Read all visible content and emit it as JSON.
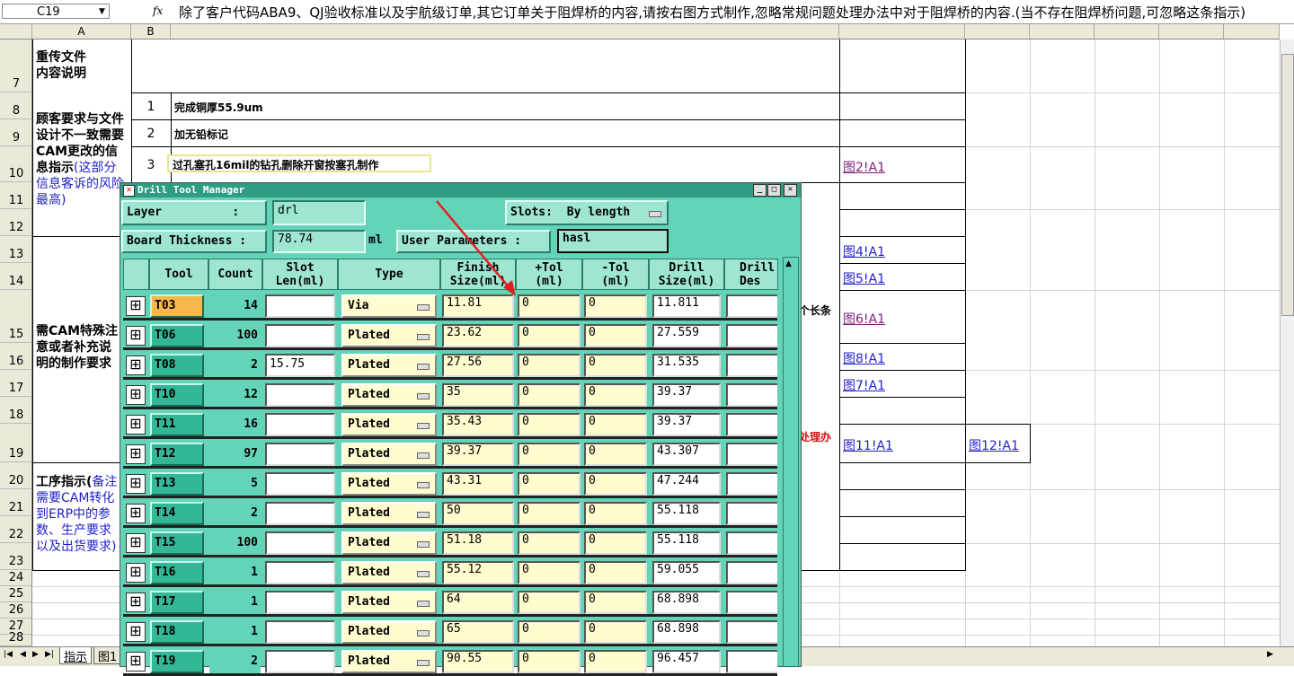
{
  "formula_bar": {
    "name_box": "C19",
    "fx": "fx",
    "formula": "除了客户代码ABA9、QJ验收标准以及宇航级订单,其它订单关于阻焊桥的内容,请按右图方式制作,忽略常规问题处理办法中对于阻焊桥的内容.(当不存在阻焊桥问题,可忽略这条指示)"
  },
  "columns": [
    "A",
    "B"
  ],
  "rows": [
    "7",
    "8",
    "9",
    "10",
    "11",
    "12",
    "13",
    "14",
    "15",
    "16",
    "17",
    "18",
    "19",
    "20",
    "21",
    "22",
    "23",
    "24",
    "25",
    "26",
    "27",
    "28"
  ],
  "sheet": {
    "a7": "重传文件\n内容说明",
    "a8_black": "顾客要求与文件设计不一致需要CAM更改的信息指示",
    "a8_blue": "(这部分信息客诉的风险最高)",
    "a15": "需CAM特殊注意或者补充说明的制作要求",
    "a20_black": "工序指示(",
    "a20_blue": "备注需要CAM转化到ERP中的参数、生产要求以及出货要求)",
    "b8": "1",
    "c8": "完成铜厚55.9um",
    "b9": "2",
    "c9": "加无铅标记",
    "b10": "3",
    "c10": "过孔塞孔16mil的钻孔删除开窗按塞孔制作",
    "frag15": "个长条",
    "frag19": "处理办",
    "links": {
      "r10": "图2!A1",
      "r13": "图4!A1",
      "r14": "图5!A1",
      "r15": "图6!A1",
      "r16": "图8!A1",
      "r17": "图7!A1",
      "r19a": "图11!A1",
      "r19b": "图12!A1"
    }
  },
  "sheet_tabs": [
    "指示",
    "图1"
  ],
  "dialog": {
    "title": "Drill Tool Manager",
    "layer_label": "Layer          :",
    "layer_value": "drl",
    "slots_label": "Slots:",
    "slots_value": "By length",
    "thickness_label": "Board Thickness :",
    "thickness_value": "78.74",
    "thickness_unit": "ml",
    "user_params_label": "User Parameters :",
    "user_params_value": "hasl",
    "headers": [
      "Tool",
      "Count",
      "Slot\nLen(ml)",
      "Type",
      "Finish\nSize(ml)",
      "+Tol\n(ml)",
      "-Tol\n(ml)",
      "Drill\nSize(ml)",
      "Drill\nDes"
    ],
    "tools": [
      {
        "tool": "T03",
        "count": "14",
        "slot": "",
        "type": "Via",
        "finish": "11.81",
        "ptol": "0",
        "ntol": "0",
        "drill": "11.811"
      },
      {
        "tool": "T06",
        "count": "100",
        "slot": "",
        "type": "Plated",
        "finish": "23.62",
        "ptol": "0",
        "ntol": "0",
        "drill": "27.559"
      },
      {
        "tool": "T08",
        "count": "2",
        "slot": "15.75",
        "type": "Plated",
        "finish": "27.56",
        "ptol": "0",
        "ntol": "0",
        "drill": "31.535"
      },
      {
        "tool": "T10",
        "count": "12",
        "slot": "",
        "type": "Plated",
        "finish": "35",
        "ptol": "0",
        "ntol": "0",
        "drill": "39.37"
      },
      {
        "tool": "T11",
        "count": "16",
        "slot": "",
        "type": "Plated",
        "finish": "35.43",
        "ptol": "0",
        "ntol": "0",
        "drill": "39.37"
      },
      {
        "tool": "T12",
        "count": "97",
        "slot": "",
        "type": "Plated",
        "finish": "39.37",
        "ptol": "0",
        "ntol": "0",
        "drill": "43.307"
      },
      {
        "tool": "T13",
        "count": "5",
        "slot": "",
        "type": "Plated",
        "finish": "43.31",
        "ptol": "0",
        "ntol": "0",
        "drill": "47.244"
      },
      {
        "tool": "T14",
        "count": "2",
        "slot": "",
        "type": "Plated",
        "finish": "50",
        "ptol": "0",
        "ntol": "0",
        "drill": "55.118"
      },
      {
        "tool": "T15",
        "count": "100",
        "slot": "",
        "type": "Plated",
        "finish": "51.18",
        "ptol": "0",
        "ntol": "0",
        "drill": "55.118"
      },
      {
        "tool": "T16",
        "count": "1",
        "slot": "",
        "type": "Plated",
        "finish": "55.12",
        "ptol": "0",
        "ntol": "0",
        "drill": "59.055"
      },
      {
        "tool": "T17",
        "count": "1",
        "slot": "",
        "type": "Plated",
        "finish": "64",
        "ptol": "0",
        "ntol": "0",
        "drill": "68.898"
      },
      {
        "tool": "T18",
        "count": "1",
        "slot": "",
        "type": "Plated",
        "finish": "65",
        "ptol": "0",
        "ntol": "0",
        "drill": "68.898"
      },
      {
        "tool": "T19",
        "count": "2",
        "slot": "",
        "type": "Plated",
        "finish": "90.55",
        "ptol": "0",
        "ntol": "0",
        "drill": "96.457"
      }
    ]
  },
  "colors": {
    "dialog_bg": "#64d4b8",
    "selected_tool": "#f6b84a",
    "link": "#1f1fcc",
    "annotation_arrow": "#e02020"
  }
}
